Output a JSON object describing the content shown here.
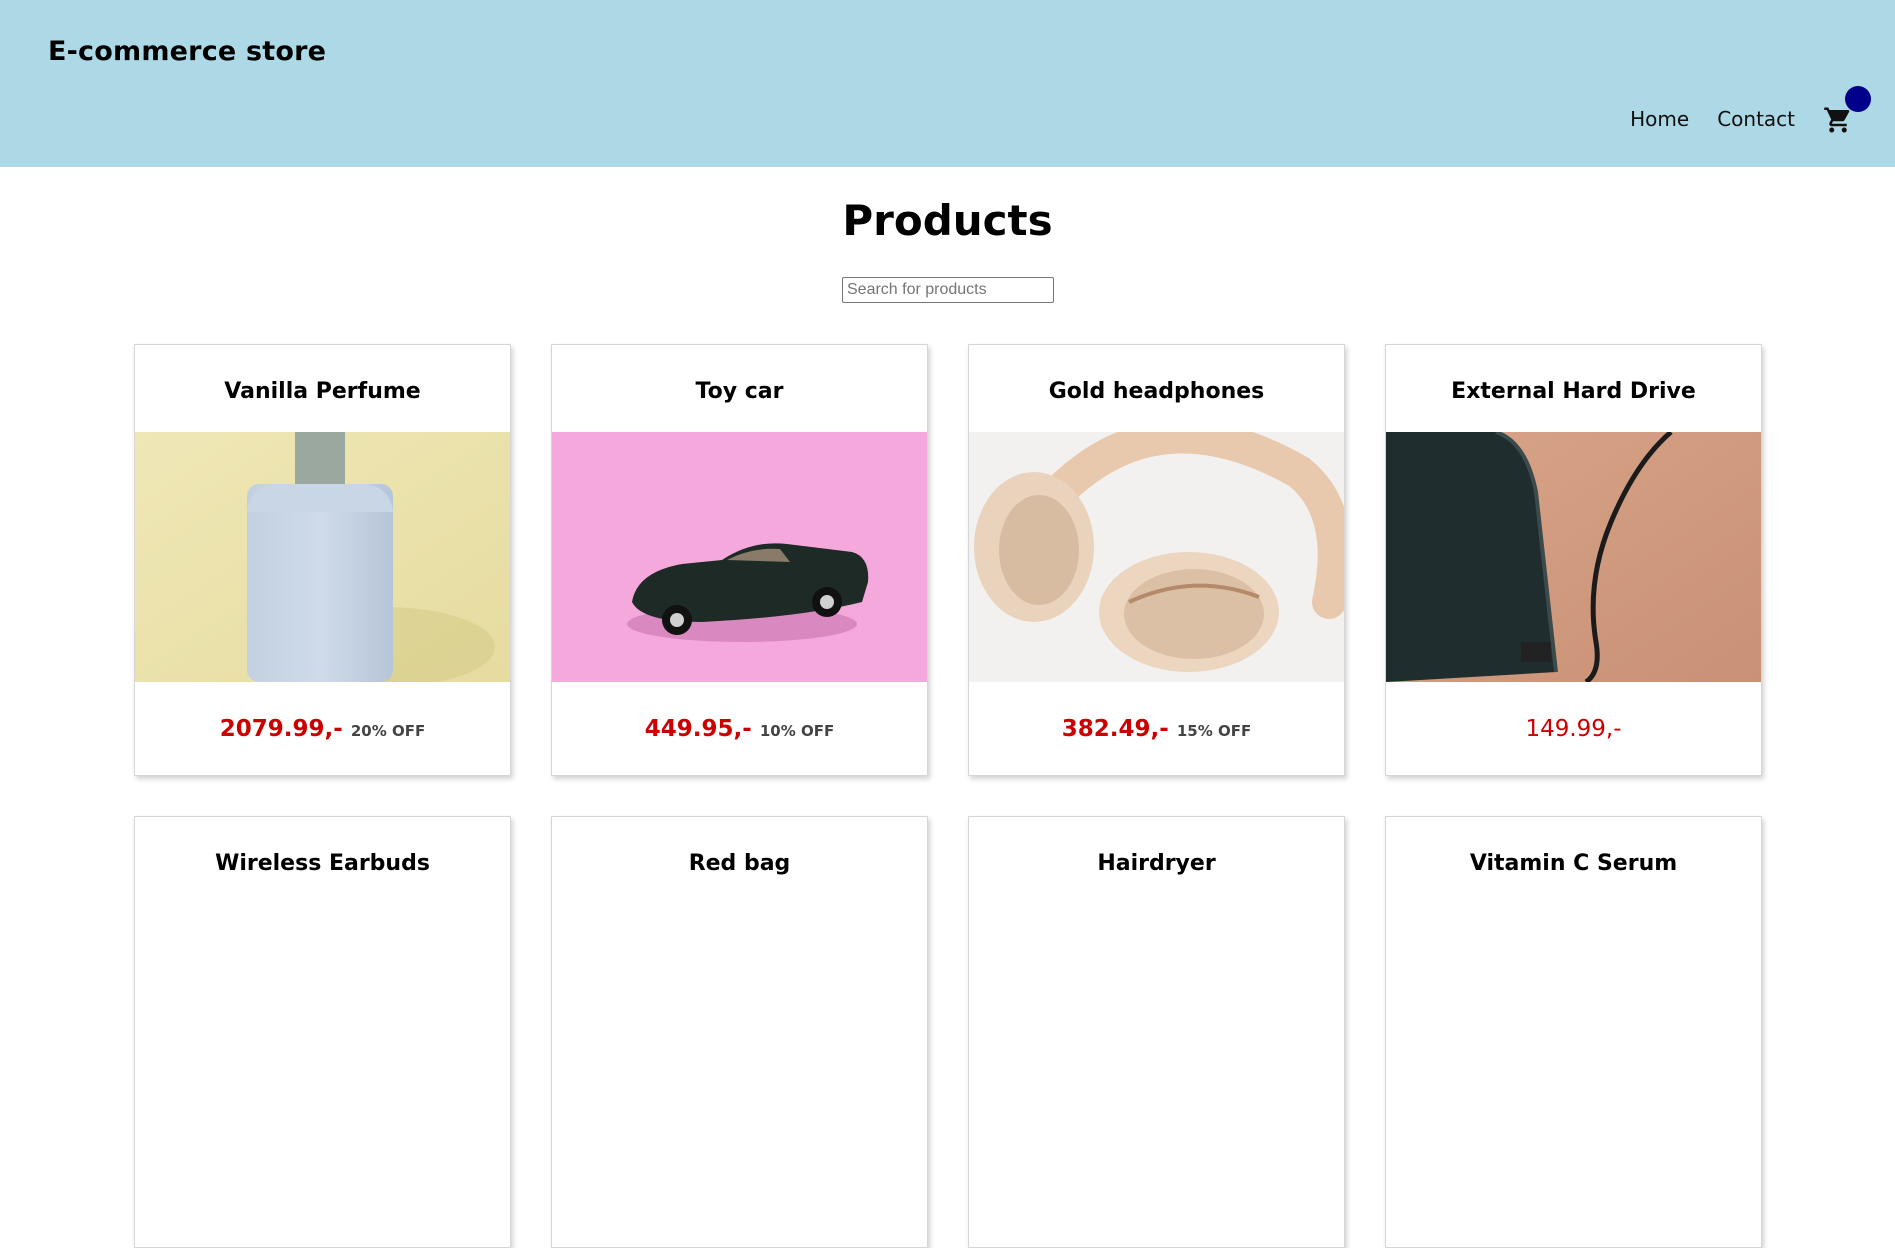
{
  "header": {
    "brand": "E-commerce store",
    "nav": [
      "Home",
      "Contact"
    ],
    "cart_icon": "shopping-cart-icon",
    "badge_color": "#00008b",
    "background_color": "#add8e6"
  },
  "main": {
    "title": "Products",
    "search": {
      "placeholder": "Search for products",
      "value": ""
    }
  },
  "products": [
    {
      "name": "Vanilla Perfume",
      "price": "2079.99,-",
      "discount": "20% OFF",
      "image": "perfume bottle on yellow background"
    },
    {
      "name": "Toy car",
      "price": "449.95,-",
      "discount": "10% OFF",
      "image": "black toy convertible car on pink background"
    },
    {
      "name": "Gold headphones",
      "price": "382.49,-",
      "discount": "15% OFF",
      "image": "rose gold over-ear headphones"
    },
    {
      "name": "External Hard Drive",
      "price": "149.99,-",
      "discount": "",
      "image": "black external hard drive with cable on wooden desk"
    },
    {
      "name": "Wireless Earbuds",
      "price": "",
      "discount": ""
    },
    {
      "name": "Red bag",
      "price": "",
      "discount": ""
    },
    {
      "name": "Hairdryer",
      "price": "",
      "discount": ""
    },
    {
      "name": "Vitamin C Serum",
      "price": "",
      "discount": ""
    }
  ],
  "colors": {
    "price": "#cc0000",
    "discount_text": "#444444"
  }
}
